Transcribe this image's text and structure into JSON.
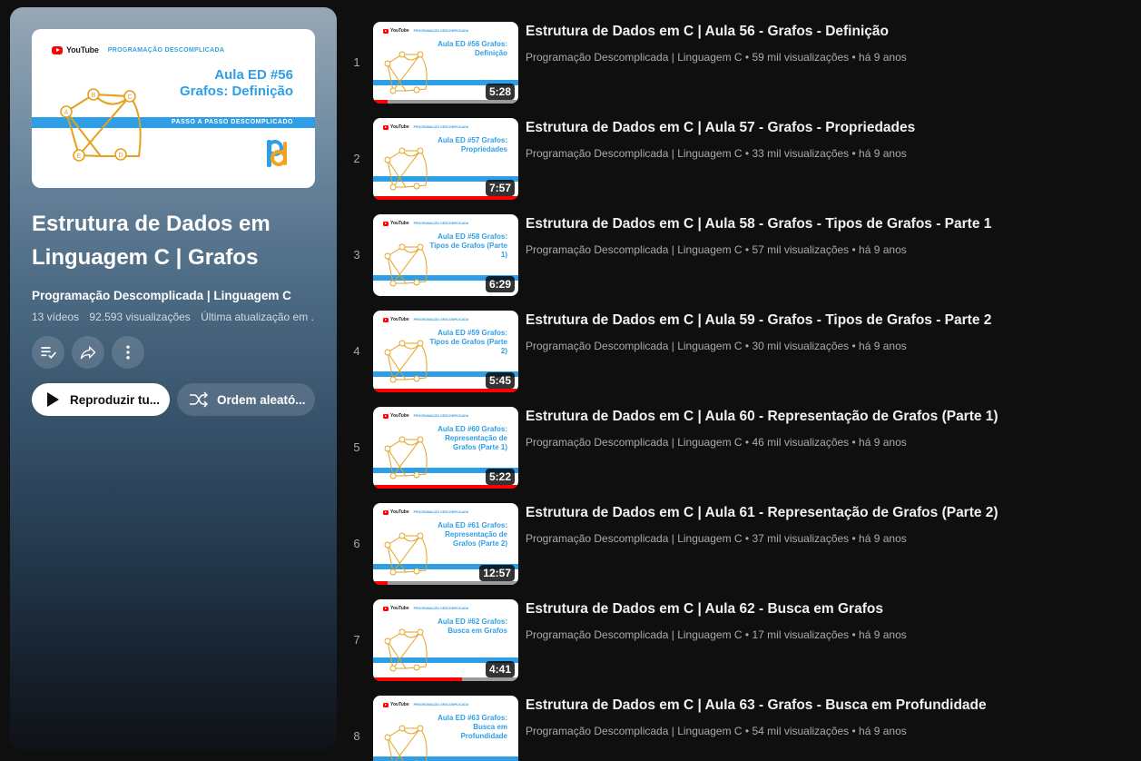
{
  "playlist": {
    "cover": {
      "brand": "YouTube",
      "channel": "PROGRAMAÇÃO DESCOMPLICADA",
      "line1": "Aula ED #56",
      "line2": "Grafos: Definição",
      "stripe": "PASSO A PASSO DESCOMPLICADO",
      "graph_nodes": [
        "A",
        "B",
        "C",
        "D",
        "E"
      ]
    },
    "title": "Estrutura de Dados em Linguagem C | Grafos",
    "owner": "Programação Descomplicada | Linguagem C",
    "video_count": "13 vídeos",
    "views": "92.593 visualizações",
    "updated": "Última atualização em ...",
    "actions": {
      "save_icon": "playlist-add-check-icon",
      "share_icon": "share-icon",
      "more_icon": "more-vert-icon"
    },
    "play_all_label": "Reproduzir tu...",
    "shuffle_label": "Ordem aleató..."
  },
  "videos": [
    {
      "index": "1",
      "title": "Estrutura de Dados em C | Aula 56 - Grafos - Definição",
      "channel": "Programação Descomplicada | Linguagem C",
      "stats": "59 mil visualizações • há 9 anos",
      "duration": "5:28",
      "thumb_text": "Aula ED #56 Grafos: Definição",
      "progress": 0.1
    },
    {
      "index": "2",
      "title": "Estrutura de Dados em C | Aula 57 - Grafos - Propriedades",
      "channel": "Programação Descomplicada | Linguagem C",
      "stats": "33 mil visualizações • há 9 anos",
      "duration": "7:57",
      "thumb_text": "Aula ED #57 Grafos: Propriedades",
      "progress": 1.0
    },
    {
      "index": "3",
      "title": "Estrutura de Dados em C | Aula 58 - Grafos - Tipos de Grafos - Parte 1",
      "channel": "Programação Descomplicada | Linguagem C",
      "stats": "57 mil visualizações • há 9 anos",
      "duration": "6:29",
      "thumb_text": "Aula ED #58 Grafos: Tipos de Grafos (Parte 1)",
      "progress": 0
    },
    {
      "index": "4",
      "title": "Estrutura de Dados em C | Aula 59 - Grafos - Tipos de Grafos - Parte 2",
      "channel": "Programação Descomplicada | Linguagem C",
      "stats": "30 mil visualizações • há 9 anos",
      "duration": "5:45",
      "thumb_text": "Aula ED #59 Grafos: Tipos de Grafos (Parte 2)",
      "progress": 1.0
    },
    {
      "index": "5",
      "title": "Estrutura de Dados em C | Aula 60 - Representação de Grafos (Parte 1)",
      "channel": "Programação Descomplicada | Linguagem C",
      "stats": "46 mil visualizações • há 9 anos",
      "duration": "5:22",
      "thumb_text": "Aula ED #60 Grafos: Representação de Grafos (Parte 1)",
      "progress": 1.0
    },
    {
      "index": "6",
      "title": "Estrutura de Dados em C | Aula 61 - Representação de Grafos (Parte 2)",
      "channel": "Programação Descomplicada | Linguagem C",
      "stats": "37 mil visualizações • há 9 anos",
      "duration": "12:57",
      "thumb_text": "Aula ED #61 Grafos: Representação de Grafos (Parte 2)",
      "progress": 0.1
    },
    {
      "index": "7",
      "title": "Estrutura de Dados em C | Aula 62 - Busca em Grafos",
      "channel": "Programação Descomplicada | Linguagem C",
      "stats": "17 mil visualizações • há 9 anos",
      "duration": "4:41",
      "thumb_text": "Aula ED #62 Grafos: Busca em Grafos",
      "progress": 0.61
    },
    {
      "index": "8",
      "title": "Estrutura de Dados em C | Aula 63 - Grafos - Busca em Profundidade",
      "channel": "Programação Descomplicada | Linguagem C",
      "stats": "54 mil visualizações • há 9 anos",
      "duration": "",
      "thumb_text": "Aula ED #63 Grafos: Busca em Profundidade",
      "progress": 0
    }
  ],
  "colors": {
    "accent": "#2e9fe6",
    "progress": "#ff0000",
    "background": "#0f0f0f"
  }
}
